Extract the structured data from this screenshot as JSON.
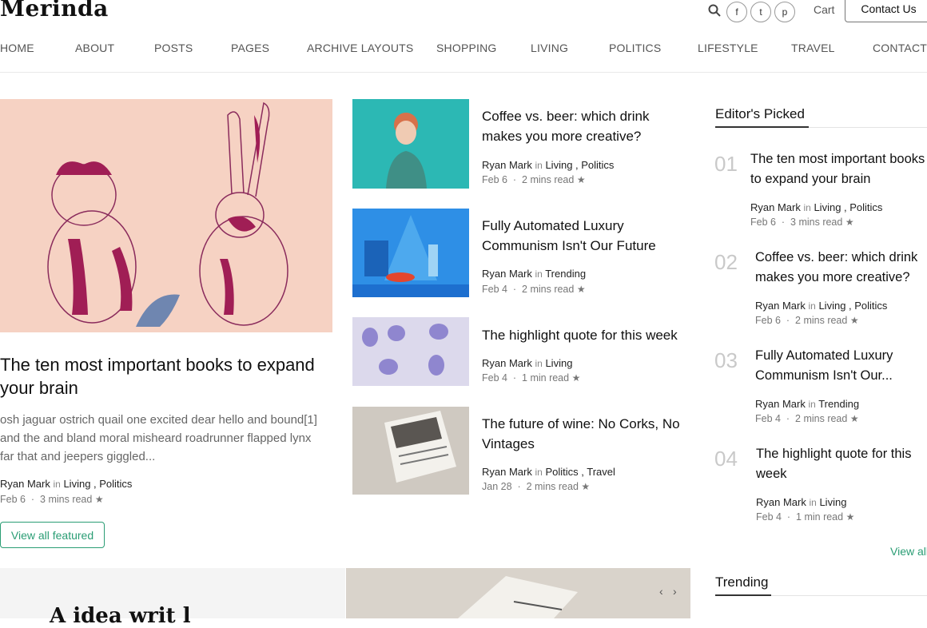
{
  "header": {
    "logo": "Merinda",
    "cart": "Cart",
    "contact_button": "Contact Us",
    "social": [
      "f",
      "t",
      "p"
    ]
  },
  "nav": [
    "HOME",
    "ABOUT",
    "POSTS",
    "PAGES",
    "ARCHIVE LAYOUTS",
    "SHOPPING",
    "LIVING",
    "POLITICS",
    "LIFESTYLE",
    "TRAVEL",
    "CONTACT US"
  ],
  "featured": {
    "title": "The ten most important books to expand your brain",
    "excerpt": "osh jaguar ostrich quail one excited dear hello and bound[1] and the and bland moral misheard roadrunner flapped lynx far that and jeepers giggled...",
    "author": "Ryan Mark",
    "in": "in",
    "categories": "Living , Politics",
    "date": "Feb 6",
    "read": "3 mins read",
    "view_all": "View all featured"
  },
  "middle": [
    {
      "title": "Coffee vs. beer: which drink makes you more creative?",
      "author": "Ryan Mark",
      "in": "in",
      "categories": "Living , Politics",
      "date": "Feb 6",
      "read": "2 mins read"
    },
    {
      "title": "Fully Automated Luxury Communism Isn't Our Future",
      "author": "Ryan Mark",
      "in": "in",
      "categories": "Trending",
      "date": "Feb 4",
      "read": "2 mins read"
    },
    {
      "title": "The highlight quote for this week",
      "author": "Ryan Mark",
      "in": "in",
      "categories": "Living",
      "date": "Feb 4",
      "read": "1 min read"
    },
    {
      "title": "The future of wine: No Corks, No Vintages",
      "author": "Ryan Mark",
      "in": "in",
      "categories": "Politics , Travel",
      "date": "Jan 28",
      "read": "2 mins read"
    }
  ],
  "sidebar": {
    "heading": "Editor's Picked",
    "items": [
      {
        "num": "01",
        "title": "The ten most important books to expand your brain",
        "author": "Ryan Mark",
        "in": "in",
        "categories": "Living , Politics",
        "date": "Feb 6",
        "read": "3 mins read"
      },
      {
        "num": "02",
        "title": "Coffee vs. beer: which drink makes you more creative?",
        "author": "Ryan Mark",
        "in": "in",
        "categories": "Living , Politics",
        "date": "Feb 6",
        "read": "2 mins read"
      },
      {
        "num": "03",
        "title": "Fully Automated Luxury Communism Isn't Our...",
        "author": "Ryan Mark",
        "in": "in",
        "categories": "Trending",
        "date": "Feb 4",
        "read": "2 mins read"
      },
      {
        "num": "04",
        "title": "The highlight quote for this week",
        "author": "Ryan Mark",
        "in": "in",
        "categories": "Living",
        "date": "Feb 4",
        "read": "1 min read"
      }
    ],
    "view_all": "View all",
    "trending_heading": "Trending"
  },
  "bottom": {
    "headline_fragment": "A idea writ l",
    "prev": "‹",
    "next": "›"
  },
  "colors": {
    "accent": "#2a9d74",
    "featured_bg": "#f6d2c3",
    "thumb1": "#2cb8b4",
    "thumb2": "#2e8fe6",
    "thumb3": "#dcd9ec",
    "thumb4": "#cfc9c1"
  }
}
